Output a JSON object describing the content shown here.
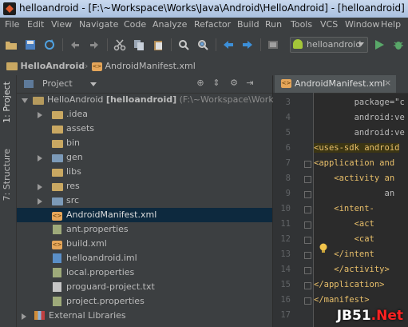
{
  "window": {
    "title": "helloandroid - [F:\\~Workspace\\Works\\Java\\Android\\HelloAndroid] - [helloandroid] - ..."
  },
  "menu": [
    "File",
    "Edit",
    "View",
    "Navigate",
    "Code",
    "Analyze",
    "Refactor",
    "Build",
    "Run",
    "Tools",
    "VCS",
    "Window",
    "Help"
  ],
  "toolbar": {
    "run_config": "helloandroid"
  },
  "breadcrumb": {
    "project": "HelloAndroid",
    "file": "AndroidManifest.xml"
  },
  "left_tabs": {
    "project": "1: Project",
    "structure": "7: Structure"
  },
  "project_panel": {
    "title": "Project",
    "root_name": "HelloAndroid",
    "root_module": "[helloandroid]",
    "root_path": "(F:\\~Workspace\\Works\\Java",
    "items": [
      {
        "label": "idea",
        "kind": "folder"
      },
      {
        "label": "assets",
        "kind": "folder"
      },
      {
        "label": "bin",
        "kind": "folder"
      },
      {
        "label": "gen",
        "kind": "folder"
      },
      {
        "label": "libs",
        "kind": "folder"
      },
      {
        "label": "res",
        "kind": "folder"
      },
      {
        "label": "src",
        "kind": "folder"
      },
      {
        "label": "AndroidManifest.xml",
        "kind": "xml"
      },
      {
        "label": "ant.properties",
        "kind": "properties"
      },
      {
        "label": "build.xml",
        "kind": "xml"
      },
      {
        "label": "helloandroid.iml",
        "kind": "iml"
      },
      {
        "label": "local.properties",
        "kind": "properties"
      },
      {
        "label": "proguard-project.txt",
        "kind": "txt"
      },
      {
        "label": "project.properties",
        "kind": "properties"
      }
    ],
    "external_libraries": "External Libraries"
  },
  "editor": {
    "tab": "AndroidManifest.xml",
    "line_numbers": [
      "3",
      "4",
      "5",
      "6",
      "7",
      "8",
      "9",
      "10",
      "11",
      "12",
      "13",
      "14",
      "15",
      "16",
      "17"
    ],
    "lines": [
      {
        "a": "        package=\"c",
        "type": "attr"
      },
      {
        "a": "        android:ve",
        "type": "attr"
      },
      {
        "a": "        android:ve",
        "type": "attr"
      },
      {
        "a": "<uses-sdk android",
        "type": "tag"
      },
      {
        "a": "<application and",
        "type": "tag"
      },
      {
        "a": "    <activity an",
        "type": "tag"
      },
      {
        "a": "              an",
        "type": "attr"
      },
      {
        "a": "    <intent-",
        "type": "tag"
      },
      {
        "a": "        <act",
        "type": "tag"
      },
      {
        "a": "        <cat",
        "type": "tag"
      },
      {
        "a": "    </intent",
        "type": "tag"
      },
      {
        "a": "    </activity>",
        "type": "tag"
      },
      {
        "a": "</application>",
        "type": "tag"
      },
      {
        "a": "</manifest>",
        "type": "tag"
      },
      {
        "a": "",
        "type": "tag"
      }
    ]
  },
  "watermark": {
    "part1": "JB51",
    "part2": ".Net"
  }
}
